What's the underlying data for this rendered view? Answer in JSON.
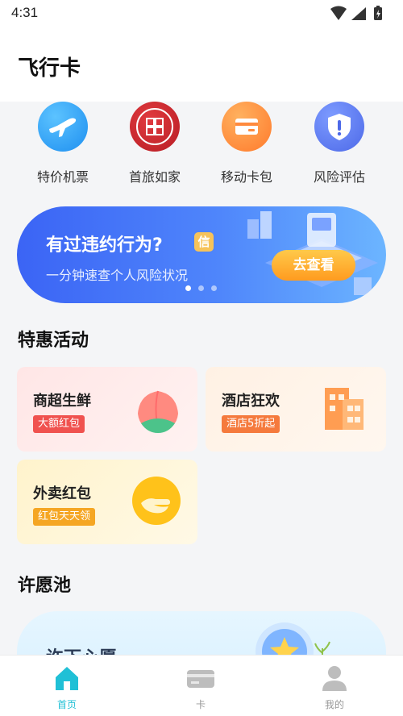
{
  "status_bar": {
    "time": "4:31"
  },
  "header": {
    "title": "飞行卡"
  },
  "quick_links": [
    {
      "label": "特价机票",
      "icon": "airplane-icon",
      "color": "#1e9df2"
    },
    {
      "label": "首旅如家",
      "icon": "hotel-seal-icon",
      "color": "#c8262d"
    },
    {
      "label": "移动卡包",
      "icon": "card-wallet-icon",
      "color": "#ff8a3d"
    },
    {
      "label": "风险评估",
      "icon": "shield-alert-icon",
      "color": "#5a78f0"
    }
  ],
  "banner": {
    "title": "有过违约行为?",
    "badge": "信",
    "subtitle": "一分钟速查个人风险状况",
    "cta": "去查看",
    "page_count": 3,
    "active_page": 1
  },
  "specials": {
    "title": "特惠活动",
    "cards": [
      {
        "title": "商超生鲜",
        "tag": "大额红包",
        "icon": "peach-icon",
        "tag_color": "#f0524f"
      },
      {
        "title": "酒店狂欢",
        "tag": "酒店5折起",
        "icon": "building-icon",
        "tag_color": "#f57a3d"
      },
      {
        "title": "外卖红包",
        "tag": "红包天天领",
        "icon": "delivery-hand-icon",
        "tag_color": "#f5a623"
      }
    ]
  },
  "wish_pool": {
    "title": "许愿池",
    "card_title": "许下心愿"
  },
  "tab_bar": {
    "tabs": [
      {
        "label": "首页",
        "icon": "home-icon",
        "active": true
      },
      {
        "label": "卡",
        "icon": "card-icon",
        "active": false
      },
      {
        "label": "我的",
        "icon": "user-icon",
        "active": false
      }
    ]
  },
  "colors": {
    "accent": "#20c0d6",
    "banner_start": "#3b64f5",
    "banner_end": "#6cb5ff",
    "cta": "#ff9b1f"
  }
}
